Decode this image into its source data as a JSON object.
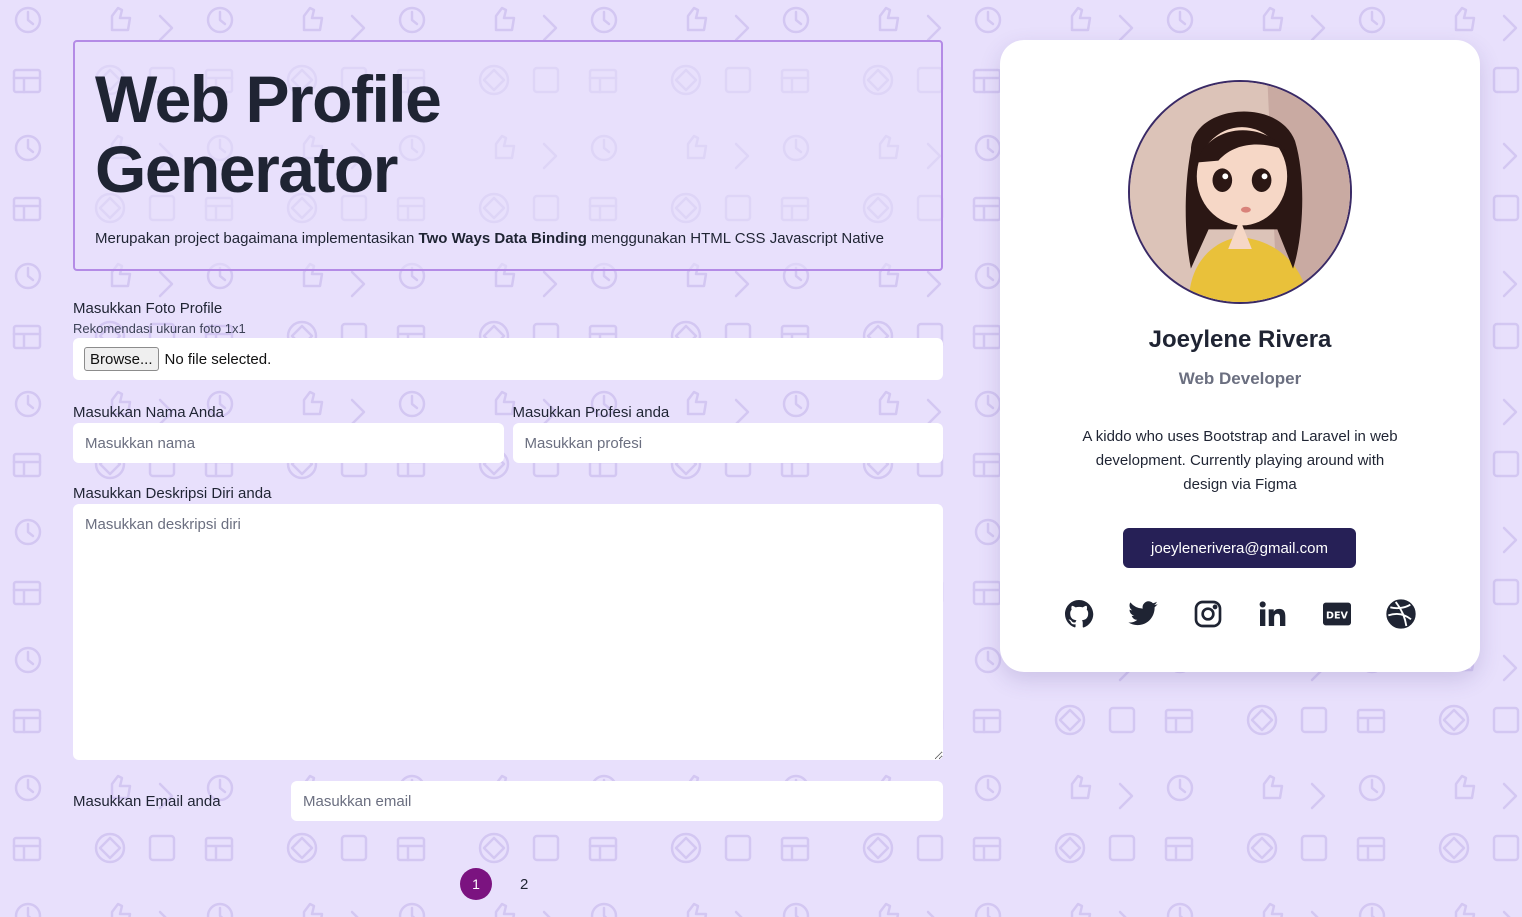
{
  "header": {
    "title_line1": "Web Profile",
    "title_line2": "Generator",
    "desc_prefix": "Merupakan project bagaimana implementasikan ",
    "desc_bold": "Two Ways Data Binding",
    "desc_suffix": " menggunakan HTML CSS Javascript Native"
  },
  "form": {
    "photo_label": "Masukkan Foto Profile",
    "photo_hint": "Rekomendasi ukuran foto 1x1",
    "browse_label": "Browse...",
    "file_status": "No file selected.",
    "name_label": "Masukkan Nama Anda",
    "name_placeholder": "Masukkan nama",
    "profession_label": "Masukkan Profesi anda",
    "profession_placeholder": "Masukkan profesi",
    "description_label": "Masukkan Deskripsi Diri anda",
    "description_placeholder": "Masukkan deskripsi diri",
    "email_label": "Masukkan Email anda",
    "email_placeholder": "Masukkan email"
  },
  "pagination": {
    "current": "1",
    "next": "2"
  },
  "profile": {
    "name": "Joeylene Rivera",
    "role": "Web Developer",
    "bio": "A kiddo who uses Bootstrap and Laravel in web development. Currently playing around with design via Figma",
    "email": "joeylenerivera@gmail.com",
    "socials": [
      "github-icon",
      "twitter-icon",
      "instagram-icon",
      "linkedin-icon",
      "dev-icon",
      "dribbble-icon"
    ]
  },
  "colors": {
    "background": "#e8e0fc",
    "accent_border": "#b48be6",
    "email_button": "#262056",
    "active_page": "#7b1380"
  }
}
